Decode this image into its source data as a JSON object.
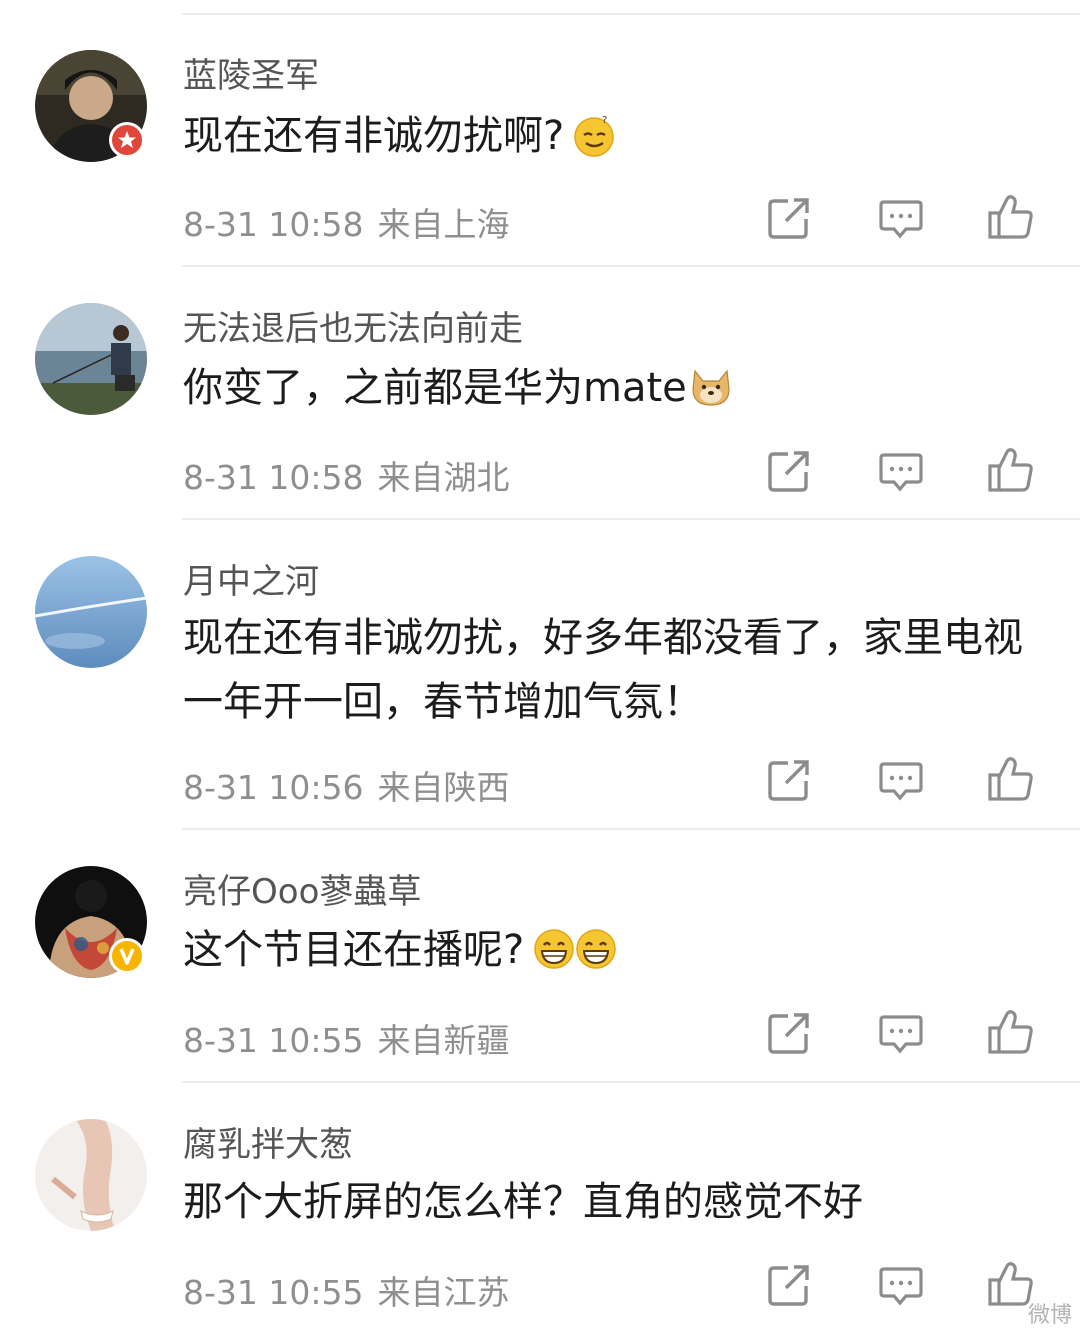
{
  "comments": [
    {
      "username": "蓝陵圣军",
      "text": "现在还有非诚勿扰啊?",
      "time": "8-31 10:58",
      "location": "来自上海",
      "emoji": "confused-smile-emoji",
      "badge": "red-star-badge"
    },
    {
      "username": "无法退后也无法向前走",
      "text": "你变了，之前都是华为mate",
      "time": "8-31 10:58",
      "location": "来自湖北",
      "emoji": "doge-emoji",
      "badge": ""
    },
    {
      "username": "月中之河",
      "text": "现在还有非诚勿扰，好多年都没看了，家里电视一年开一回，春节增加气氛！",
      "time": "8-31 10:56",
      "location": "来自陕西",
      "emoji": "",
      "badge": ""
    },
    {
      "username": "亮仔Ooo蓼蟲草",
      "text": "这个节目还在播呢?",
      "time": "8-31 10:55",
      "location": "来自新疆",
      "emoji": "grin-emoji",
      "badge": "yellow-v-badge"
    },
    {
      "username": "腐乳拌大葱",
      "text": "那个大折屏的怎么样？直角的感觉不好",
      "time": "8-31 10:55",
      "location": "来自江苏",
      "emoji": "",
      "badge": ""
    }
  ],
  "icons": {
    "share": "share-icon",
    "comment": "comment-icon",
    "like": "thumbs-up-icon"
  },
  "colors": {
    "text": "#1c1c1c",
    "username": "#555555",
    "meta": "#8f8f8f",
    "icon": "#8c8c8c",
    "divider": "#ececec"
  },
  "watermark": "微博"
}
